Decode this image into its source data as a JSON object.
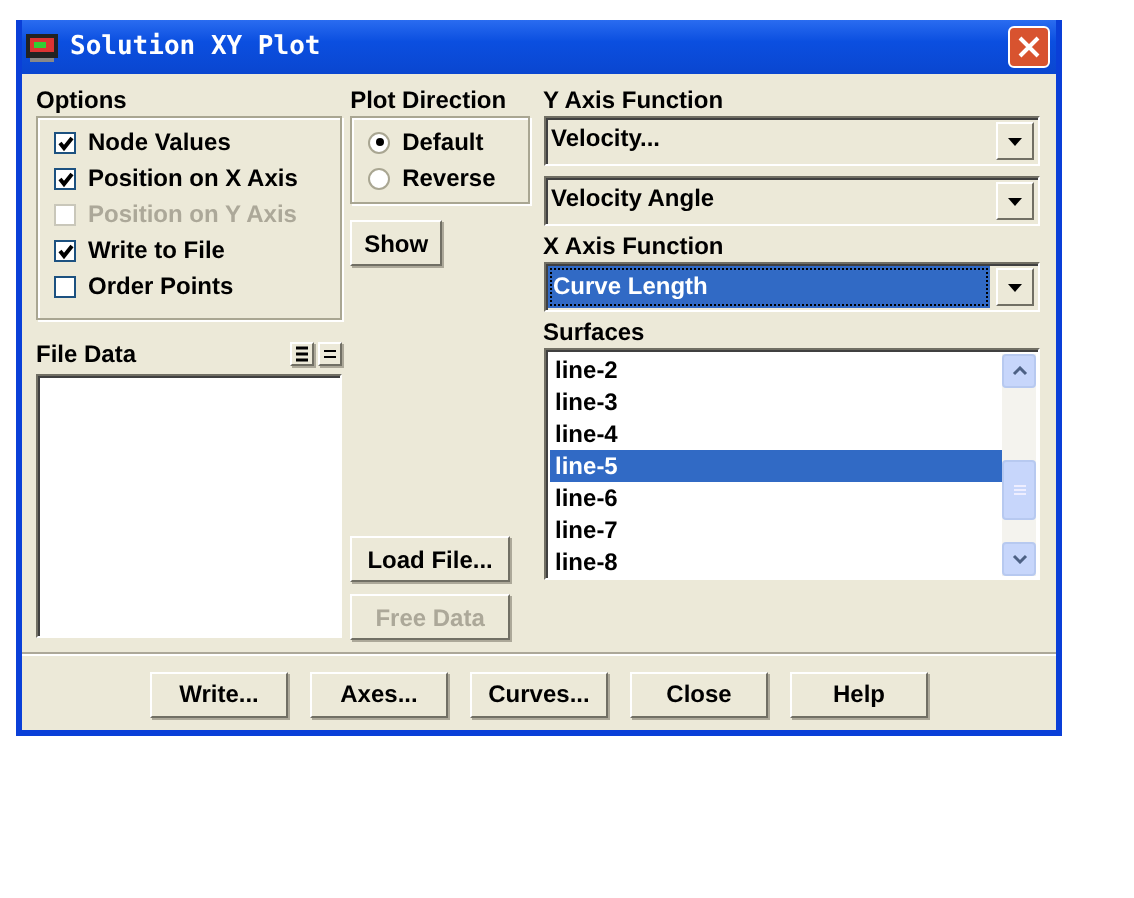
{
  "window": {
    "title": "Solution XY Plot"
  },
  "options": {
    "label": "Options",
    "items": [
      {
        "label": "Node Values",
        "checked": true,
        "disabled": false
      },
      {
        "label": "Position on X Axis",
        "checked": true,
        "disabled": false
      },
      {
        "label": "Position on Y Axis",
        "checked": false,
        "disabled": true
      },
      {
        "label": "Write to File",
        "checked": true,
        "disabled": false
      },
      {
        "label": "Order Points",
        "checked": false,
        "disabled": false
      }
    ]
  },
  "plot_direction": {
    "label": "Plot Direction",
    "items": [
      {
        "label": "Default",
        "selected": true
      },
      {
        "label": "Reverse",
        "selected": false
      }
    ]
  },
  "show_button": {
    "label": "Show",
    "disabled": false
  },
  "y_axis_function": {
    "label": "Y Axis Function",
    "dropdowns": [
      {
        "value": "Velocity...",
        "focused": false
      },
      {
        "value": "Velocity Angle",
        "focused": false
      }
    ]
  },
  "x_axis_function": {
    "label": "X Axis Function",
    "dropdowns": [
      {
        "value": "Curve Length",
        "focused": true
      }
    ]
  },
  "file_data": {
    "label": "File Data"
  },
  "side_buttons": [
    {
      "label": "Load File...",
      "disabled": false
    },
    {
      "label": "Free Data",
      "disabled": true
    }
  ],
  "surfaces": {
    "label": "Surfaces",
    "items": [
      {
        "label": "line-2",
        "selected": false
      },
      {
        "label": "line-3",
        "selected": false
      },
      {
        "label": "line-4",
        "selected": false
      },
      {
        "label": "line-5",
        "selected": true
      },
      {
        "label": "line-6",
        "selected": false
      },
      {
        "label": "line-7",
        "selected": false
      },
      {
        "label": "line-8",
        "selected": false
      }
    ]
  },
  "buttons": [
    {
      "label": "Write..."
    },
    {
      "label": "Axes..."
    },
    {
      "label": "Curves..."
    },
    {
      "label": "Close"
    },
    {
      "label": "Help"
    }
  ]
}
